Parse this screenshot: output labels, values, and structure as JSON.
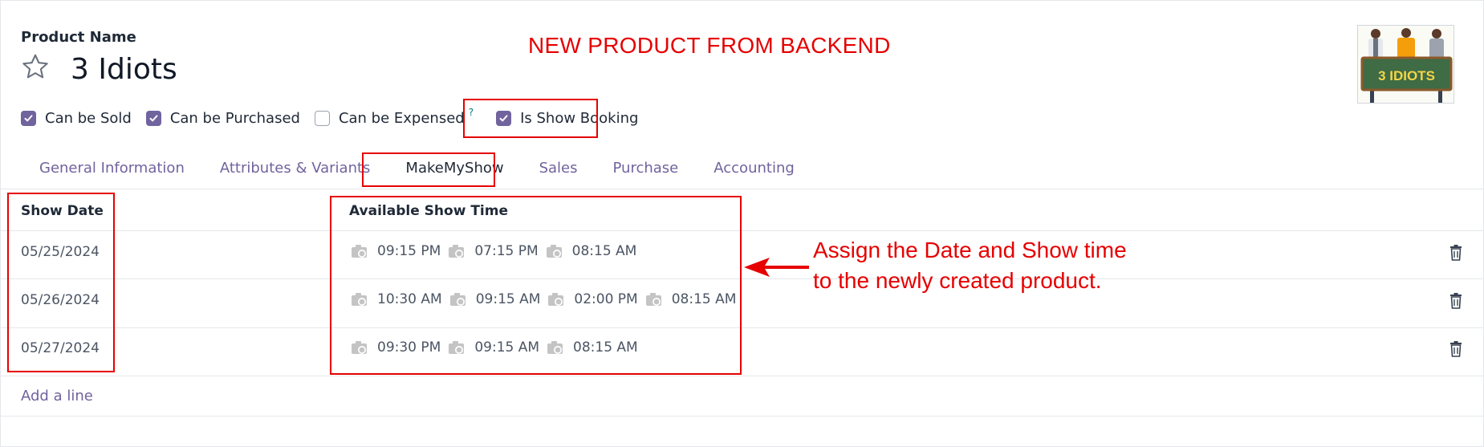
{
  "form": {
    "product_name_label": "Product Name",
    "product_name": "3 Idiots",
    "favorite_icon": "star-outline-icon"
  },
  "banner": "NEW PRODUCT FROM BACKEND",
  "poster": {
    "title_text": "3 IDIOTS"
  },
  "options": [
    {
      "label": "Can be Sold",
      "checked": true
    },
    {
      "label": "Can be Purchased",
      "checked": true
    },
    {
      "label": "Can be Expensed",
      "checked": false,
      "help": "?"
    },
    {
      "label": "Is Show Booking",
      "checked": true
    }
  ],
  "tabs": [
    "General Information",
    "Attributes & Variants",
    "MakeMyShow",
    "Sales",
    "Purchase",
    "Accounting"
  ],
  "active_tab": "MakeMyShow",
  "table": {
    "columns": [
      "Show Date",
      "Available Show Time"
    ],
    "rows": [
      {
        "date": "05/25/2024",
        "times": [
          "09:15 PM",
          "07:15 PM",
          "08:15 AM"
        ]
      },
      {
        "date": "05/26/2024",
        "times": [
          "10:30 AM",
          "09:15 AM",
          "02:00 PM",
          "08:15 AM"
        ]
      },
      {
        "date": "05/27/2024",
        "times": [
          "09:30 PM",
          "09:15 AM",
          "08:15 AM"
        ]
      }
    ],
    "add_line": "Add a line"
  },
  "annotation": {
    "line1": "Assign the Date and Show time",
    "line2": "to the newly created product."
  },
  "colors": {
    "accent": "#71639e",
    "annotation_red": "#e60000",
    "border": "#e5e7eb"
  }
}
